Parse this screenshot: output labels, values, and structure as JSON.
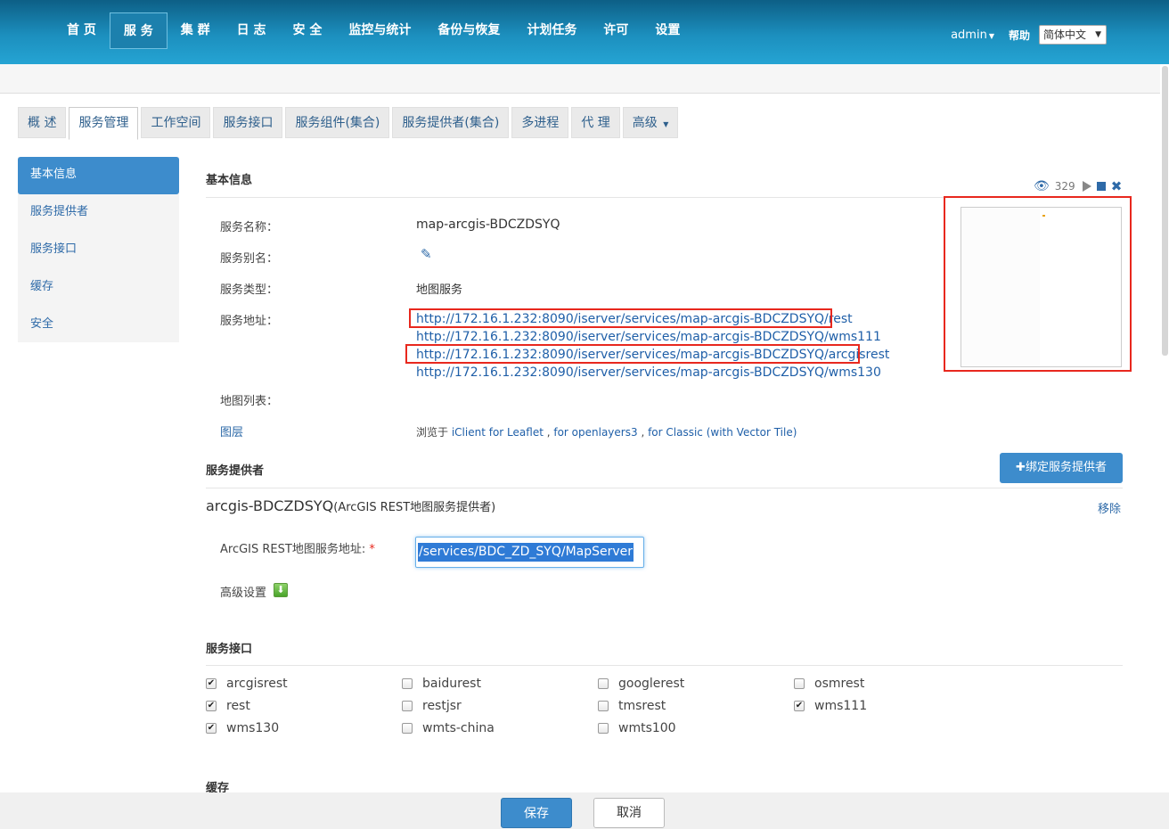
{
  "topnav": {
    "items": [
      "首 页",
      "服 务",
      "集 群",
      "日 志",
      "安 全",
      "监控与统计",
      "备份与恢复",
      "计划任务",
      "许可",
      "设置"
    ],
    "active_index": 1,
    "user": "admin",
    "help": "帮助",
    "language": "简体中文"
  },
  "tabs": [
    "概 述",
    "服务管理",
    "工作空间",
    "服务接口",
    "服务组件(集合)",
    "服务提供者(集合)",
    "多进程",
    "代 理",
    "高级"
  ],
  "sidebar": [
    "基本信息",
    "服务提供者",
    "服务接口",
    "缓存",
    "安全"
  ],
  "basic": {
    "title": "基本信息",
    "view_count": "329",
    "name_label": "服务名称：",
    "name_value": "map-arcgis-BDCZDSYQ",
    "alias_label": "服务别名：",
    "type_label": "服务类型：",
    "type_value": "地图服务",
    "address_label": "服务地址：",
    "urls": [
      "http://172.16.1.232:8090/iserver/services/map-arcgis-BDCZDSYQ/rest",
      "http://172.16.1.232:8090/iserver/services/map-arcgis-BDCZDSYQ/wms111",
      "http://172.16.1.232:8090/iserver/services/map-arcgis-BDCZDSYQ/arcgisrest",
      "http://172.16.1.232:8090/iserver/services/map-arcgis-BDCZDSYQ/wms130"
    ],
    "maplist_label": "地图列表：",
    "layer_link": "图层",
    "browse_prefix": "浏览于",
    "browse_leaflet": "iClient for Leaflet",
    "browse_ol": "for openlayers3",
    "browse_classic": "for Classic (with Vector Tile)"
  },
  "provider": {
    "title": "服务提供者",
    "bind_button": "绑定服务提供者",
    "name": "arcgis-BDCZDSYQ",
    "type": "(ArcGIS REST地图服务提供者)",
    "remove": "移除",
    "addr_label": "ArcGIS REST地图服务地址:",
    "required_mark": "*",
    "addr_value": "/services/BDC_ZD_SYQ/MapServer",
    "advanced": "高级设置"
  },
  "interfaces": {
    "title": "服务接口",
    "items": [
      {
        "label": "arcgisrest",
        "checked": true
      },
      {
        "label": "baidurest",
        "checked": false
      },
      {
        "label": "googlerest",
        "checked": false
      },
      {
        "label": "osmrest",
        "checked": false
      },
      {
        "label": "rest",
        "checked": true
      },
      {
        "label": "restjsr",
        "checked": false
      },
      {
        "label": "tmsrest",
        "checked": false
      },
      {
        "label": "wms111",
        "checked": true
      },
      {
        "label": "wms130",
        "checked": true
      },
      {
        "label": "wmts-china",
        "checked": false
      },
      {
        "label": "wmts100",
        "checked": false
      }
    ]
  },
  "cache": {
    "title": "缓存"
  },
  "footer": {
    "save": "保存",
    "cancel": "取消"
  }
}
